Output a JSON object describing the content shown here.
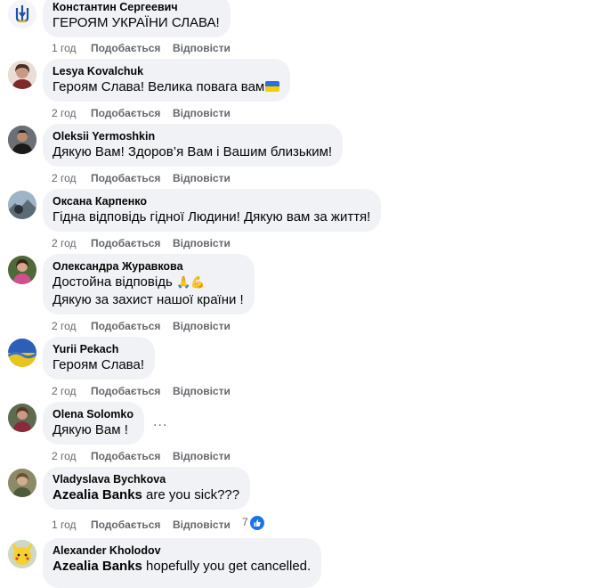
{
  "comments": [
    {
      "author": "Константин Сергеевич",
      "lines": [
        "ГЕРОЯМ УКРАЇНИ СЛАВА!"
      ],
      "time": "1 год",
      "like": "Подобається",
      "reply": "Відповісти"
    },
    {
      "author": "Lesya Kovalchuk",
      "lines": [
        "Героям Слава! Велика повага вам"
      ],
      "time": "2 год",
      "like": "Подобається",
      "reply": "Відповісти"
    },
    {
      "author": "Oleksii Yermoshkin",
      "lines": [
        "Дякую Вам! Здоров’я Вам і Вашим близьким!"
      ],
      "time": "2 год",
      "like": "Подобається",
      "reply": "Відповісти"
    },
    {
      "author": "Оксана Карпенко",
      "lines": [
        "Гідна відповідь гідної Людини! Дякую вам за життя!"
      ],
      "time": "2 год",
      "like": "Подобається",
      "reply": "Відповісти"
    },
    {
      "author": "Олександра Журавкова",
      "lines": [
        "Достойна відповідь",
        "Дякую за захист нашої країни !"
      ],
      "time": "2 год",
      "like": "Подобається",
      "reply": "Відповісти"
    },
    {
      "author": "Yurii Pekach",
      "lines": [
        "Героям Слава!"
      ],
      "time": "2 год",
      "like": "Подобається",
      "reply": "Відповісти"
    },
    {
      "author": "Olena Solomko",
      "lines": [
        "Дякую Вам !"
      ],
      "time": "2 год",
      "like": "Подобається",
      "reply": "Відповісти",
      "more": "..."
    },
    {
      "author": "Vladyslava Bychkova",
      "mention": "Azealia Banks",
      "after_mention": " are you sick???",
      "time": "1 год",
      "like": "Подобається",
      "reply": "Відповісти",
      "reaction_count": "7"
    },
    {
      "author": "Alexander Kholodov",
      "mention": "Azealia Banks",
      "after_mention": " hopefully you get cancelled."
    }
  ]
}
